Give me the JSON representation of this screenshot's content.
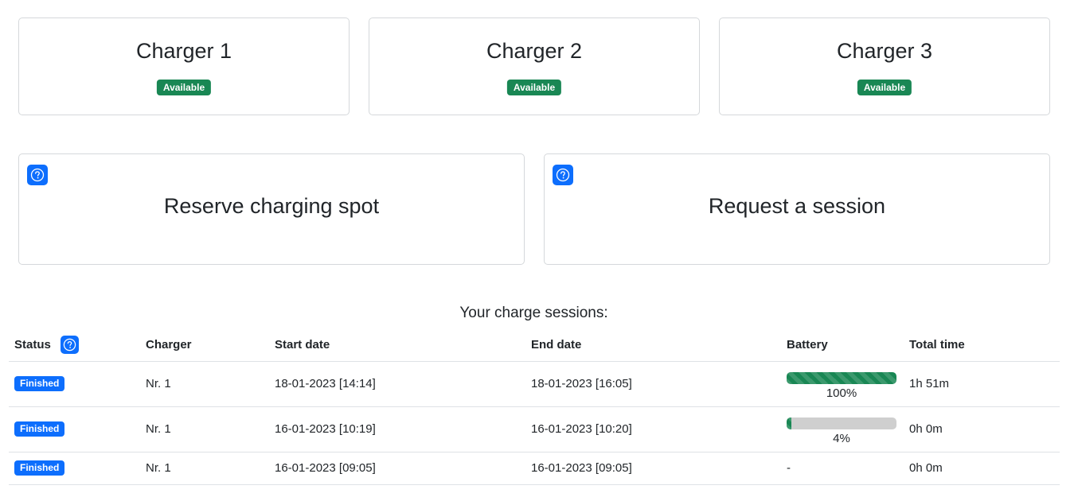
{
  "chargers": [
    {
      "name": "Charger 1",
      "status": "Available"
    },
    {
      "name": "Charger 2",
      "status": "Available"
    },
    {
      "name": "Charger 3",
      "status": "Available"
    }
  ],
  "actions": {
    "reserve": {
      "label": "Reserve charging spot",
      "icon": "help-circle-icon"
    },
    "request": {
      "label": "Request a session",
      "icon": "help-circle-icon"
    }
  },
  "sessions": {
    "title": "Your charge sessions:",
    "columns": {
      "status": "Status",
      "charger": "Charger",
      "start": "Start date",
      "end": "End date",
      "battery": "Battery",
      "total": "Total time"
    },
    "rows": [
      {
        "status": "Finished",
        "charger": "Nr. 1",
        "start": "18-01-2023 [14:14]",
        "end": "18-01-2023 [16:05]",
        "battery_percent": 100,
        "battery_label": "100%",
        "total": "1h 51m"
      },
      {
        "status": "Finished",
        "charger": "Nr. 1",
        "start": "16-01-2023 [10:19]",
        "end": "16-01-2023 [10:20]",
        "battery_percent": 4,
        "battery_label": "4%",
        "total": "0h 0m"
      },
      {
        "status": "Finished",
        "charger": "Nr. 1",
        "start": "16-01-2023 [09:05]",
        "end": "16-01-2023 [09:05]",
        "battery_text": "-",
        "total": "0h 0m"
      }
    ]
  },
  "colors": {
    "available": "#198754",
    "primary": "#0d6efd",
    "battery_track": "#cfcfcf"
  }
}
